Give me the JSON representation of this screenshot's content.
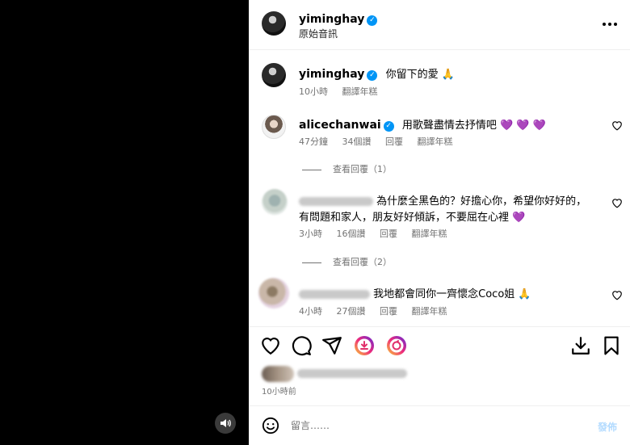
{
  "colors": {
    "verified": "#0095f6",
    "secondary_text": "#737373",
    "post_button": "#b3dbff",
    "emoji_heart": "#7b3fc1"
  },
  "header": {
    "username": "yiminghay",
    "subtitle": "原始音訊",
    "verified_icon": "✓"
  },
  "caption": {
    "username": "yiminghay",
    "text": "你留下的愛 🙏",
    "time": "10小時",
    "translate": "翻譯年糕"
  },
  "comments": [
    {
      "username": "alicechanwai",
      "verified": true,
      "text": "用歌聲盡情去抒情吧 💜 💜 💜",
      "time": "47分鐘",
      "likes": "34個讚",
      "reply": "回覆",
      "translate": "翻譯年糕"
    },
    {
      "username_blurred": true,
      "text_line1": "為什麼全黑色的？好擔心你，希望你好好的，",
      "text_line2": "有問題和家人，朋友好好傾訴，不要屈在心裡 💜",
      "time": "3小時",
      "likes": "16個讚",
      "reply": "回覆",
      "translate": "翻譯年糕"
    },
    {
      "username_blurred": true,
      "text": "我地都會同你一齊懷念Coco姐 🙏",
      "time": "4小時",
      "likes": "27個讚",
      "reply": "回覆",
      "translate": "翻譯年糕"
    }
  ],
  "view_replies": [
    "查看回覆（1）",
    "查看回覆（2）"
  ],
  "actions": {
    "icons": [
      "heart-icon",
      "comment-icon",
      "share-icon",
      "remix-icon",
      "loop-icon",
      "download-icon",
      "bookmark-icon"
    ]
  },
  "post_time": "10小時前",
  "comment_bar": {
    "placeholder": "留言……",
    "post": "發佈"
  }
}
